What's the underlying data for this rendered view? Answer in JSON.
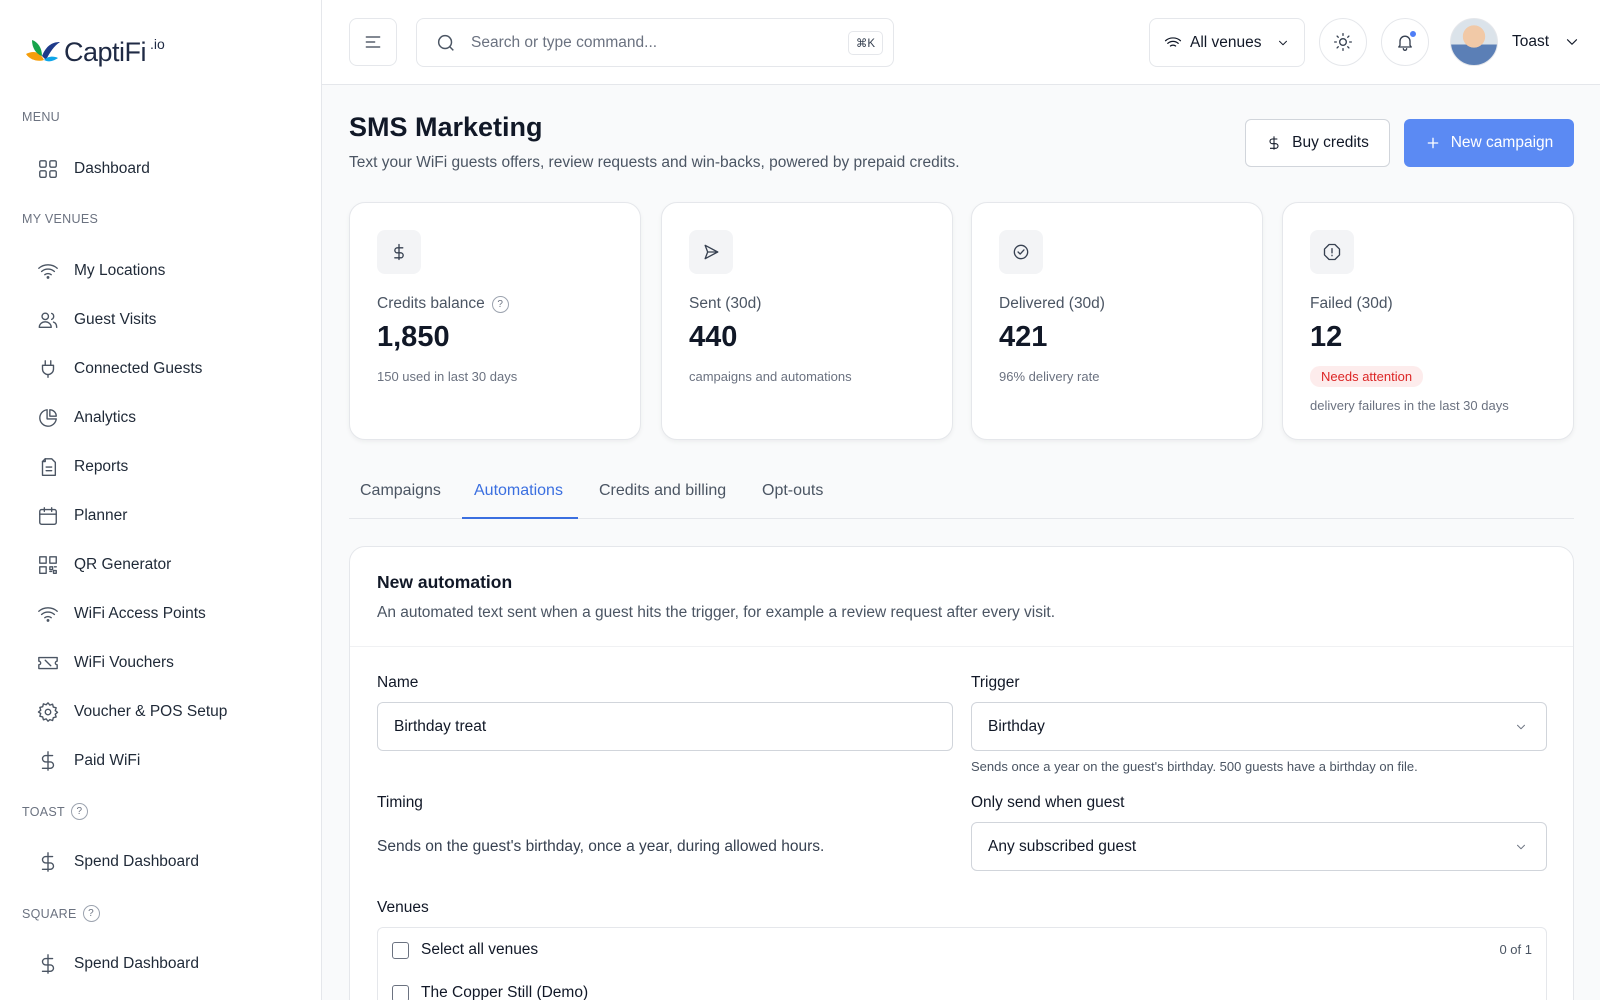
{
  "brand": {
    "name": "CaptiFi",
    "suffix": ".io"
  },
  "sidebar": {
    "sections": {
      "menu": "MENU",
      "my_venues": "MY VENUES",
      "toast": "TOAST",
      "square": "SQUARE"
    },
    "items": [
      {
        "label": "Dashboard",
        "icon": "grid-icon"
      },
      {
        "label": "My Locations",
        "icon": "wifi-icon"
      },
      {
        "label": "Guest Visits",
        "icon": "users-icon"
      },
      {
        "label": "Connected Guests",
        "icon": "plug-icon"
      },
      {
        "label": "Analytics",
        "icon": "pie-chart-icon"
      },
      {
        "label": "Reports",
        "icon": "document-icon"
      },
      {
        "label": "Planner",
        "icon": "calendar-icon"
      },
      {
        "label": "QR Generator",
        "icon": "qr-icon"
      },
      {
        "label": "WiFi Access Points",
        "icon": "wifi-icon"
      },
      {
        "label": "WiFi Vouchers",
        "icon": "ticket-icon"
      },
      {
        "label": "Voucher & POS Setup",
        "icon": "gear-icon"
      },
      {
        "label": "Paid WiFi",
        "icon": "dollar-icon"
      },
      {
        "label": "Spend Dashboard",
        "icon": "dollar-icon"
      },
      {
        "label": "Spend Dashboard",
        "icon": "dollar-icon"
      }
    ],
    "help": "?"
  },
  "header": {
    "search_placeholder": "Search or type command...",
    "shortcut": "⌘K",
    "venue_filter": "All venues",
    "user_name": "Toast"
  },
  "page": {
    "title": "SMS Marketing",
    "subtitle": "Text your WiFi guests offers, review requests and win-backs, powered by prepaid credits.",
    "buy_credits": "Buy credits",
    "new_campaign": "New campaign"
  },
  "stats": [
    {
      "label": "Credits balance",
      "value": "1,850",
      "note": "150 used in last 30 days",
      "icon": "dollar-icon"
    },
    {
      "label": "Sent (30d)",
      "value": "440",
      "note": "campaigns and automations",
      "icon": "send-icon"
    },
    {
      "label": "Delivered (30d)",
      "value": "421",
      "note": "96% delivery rate",
      "icon": "check-circle-icon"
    },
    {
      "label": "Failed (30d)",
      "value": "12",
      "badge": "Needs attention",
      "note": "delivery failures in the last 30 days",
      "icon": "alert-octagon-icon"
    }
  ],
  "tabs": [
    "Campaigns",
    "Automations",
    "Credits and billing",
    "Opt-outs"
  ],
  "active_tab": "Automations",
  "form": {
    "title": "New automation",
    "subtitle": "An automated text sent when a guest hits the trigger, for example a review request after every visit.",
    "name_label": "Name",
    "name_value": "Birthday treat",
    "trigger_label": "Trigger",
    "trigger_value": "Birthday",
    "trigger_help": "Sends once a year on the guest's birthday. 500 guests have a birthday on file.",
    "timing_label": "Timing",
    "timing_text": "Sends on the guest's birthday, once a year, during allowed hours.",
    "condition_label": "Only send when guest",
    "condition_value": "Any subscribed guest",
    "venues_label": "Venues",
    "select_all": "Select all venues",
    "venue_count": "0 of 1",
    "venue_1": "The Copper Still (Demo)"
  },
  "colors": {
    "accent": "#5b8af3",
    "danger": "#dc2626"
  }
}
